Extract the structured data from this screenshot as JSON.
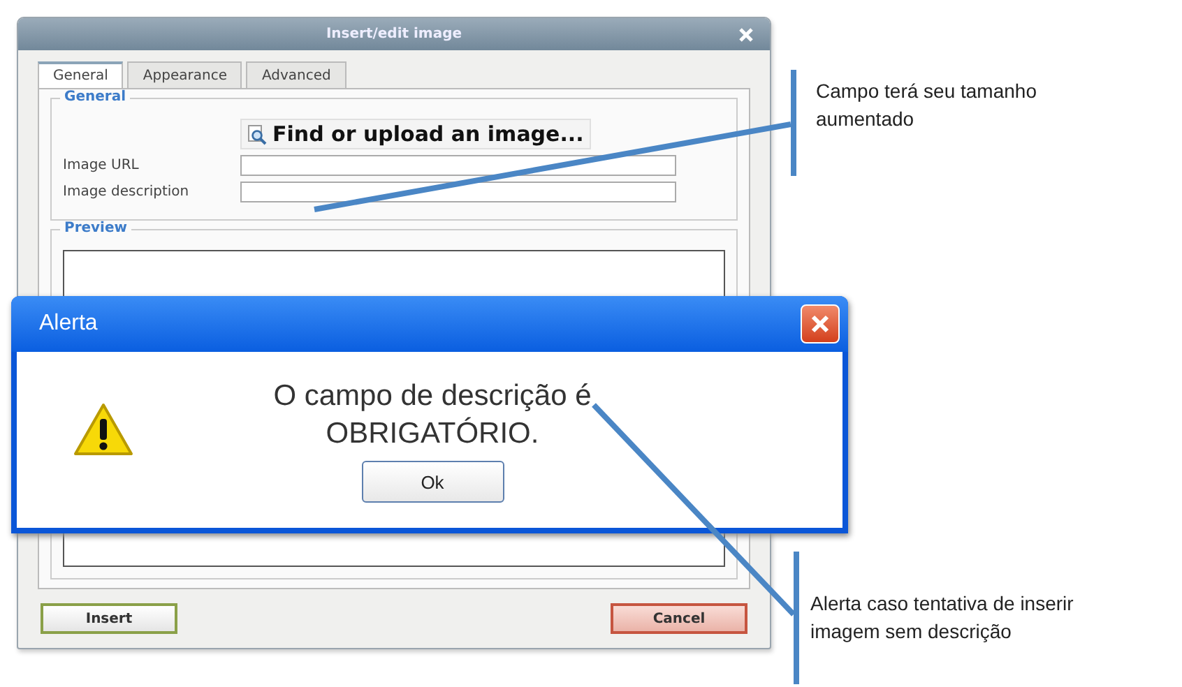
{
  "dialog": {
    "title": "Insert/edit image",
    "tabs": [
      {
        "label": "General",
        "selected": true
      },
      {
        "label": "Appearance",
        "selected": false
      },
      {
        "label": "Advanced",
        "selected": false
      }
    ],
    "general": {
      "legend": "General",
      "find_button": "Find or upload an image...",
      "fields": [
        {
          "label": "Image URL"
        },
        {
          "label": "Image description"
        }
      ]
    },
    "preview": {
      "legend": "Preview"
    },
    "buttons": [
      {
        "label": "Insert",
        "kind": "insert"
      },
      {
        "label": "Cancel",
        "kind": "cancel"
      }
    ]
  },
  "alert": {
    "title": "Alerta",
    "message": "O campo de descrição é OBRIGATÓRIO.",
    "button": "Ok"
  },
  "annotations": [
    {
      "text": "Campo terá seu tamanho aumentado"
    },
    {
      "text": "Alerta caso tentativa de inserir imagem sem descrição"
    }
  ]
}
